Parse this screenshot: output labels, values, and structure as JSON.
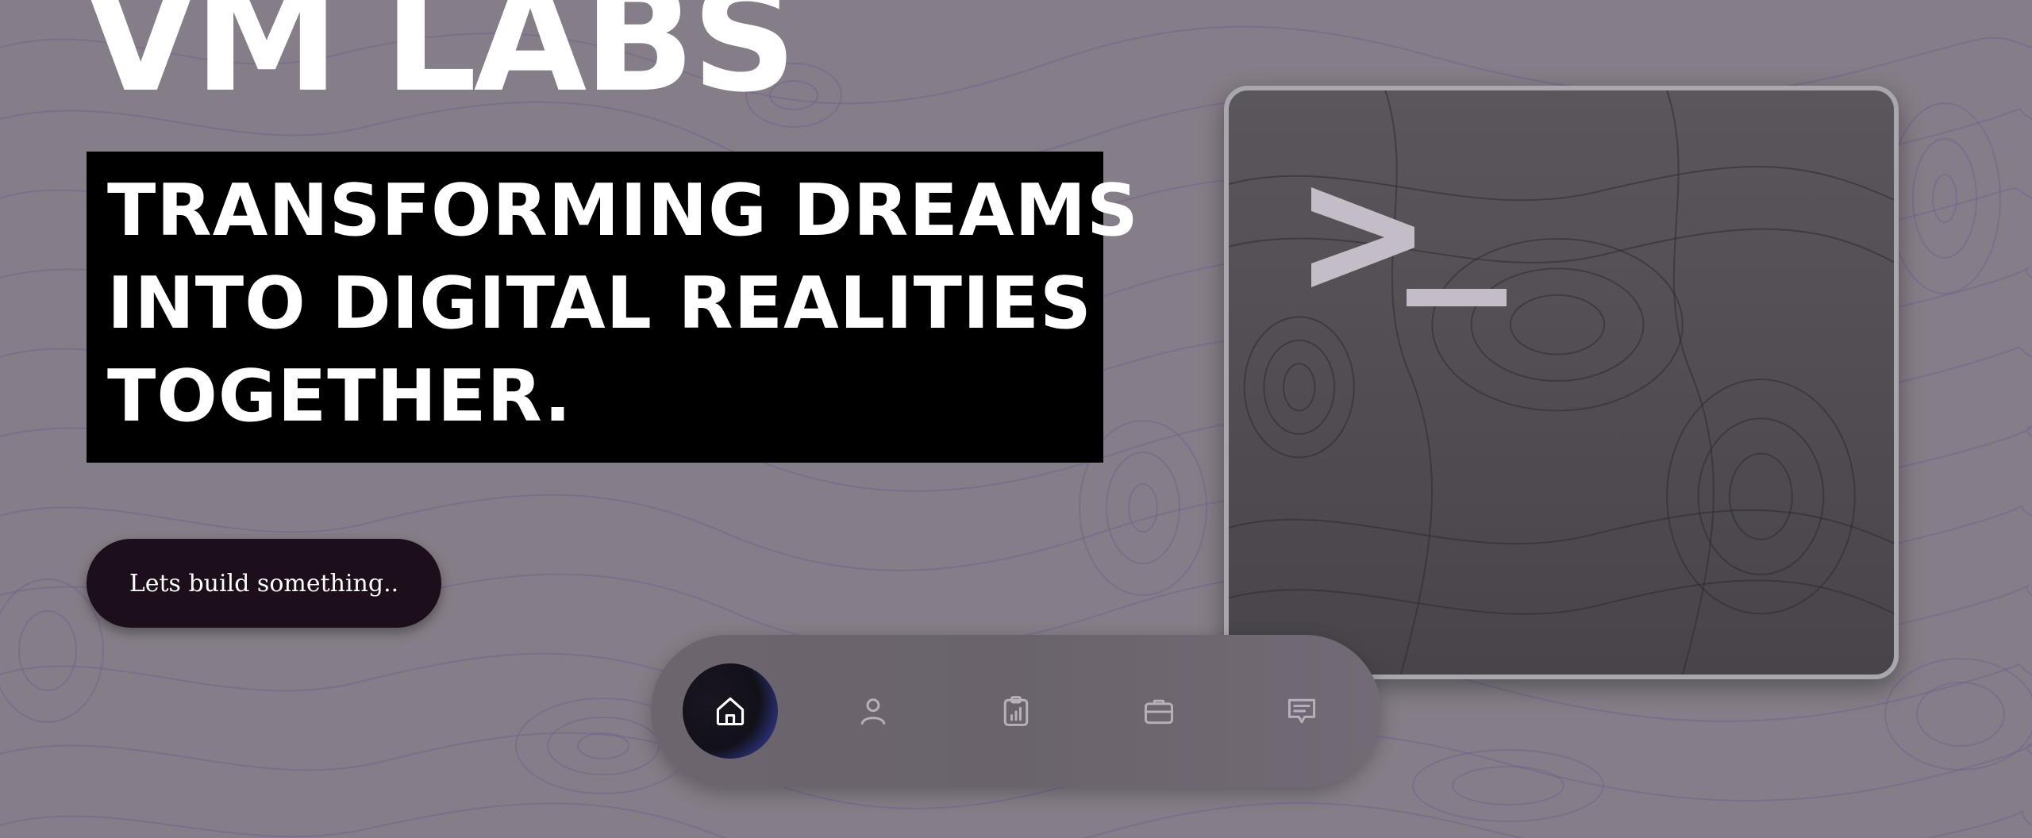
{
  "brand": {
    "name": "VM LABS"
  },
  "hero": {
    "lines": [
      "TRANSFORMING DREAMS",
      "INTO DIGITAL REALITIES",
      "TOGETHER."
    ]
  },
  "cta": {
    "label": "Lets build something.."
  },
  "terminal": {
    "icon": "terminal-prompt-icon"
  },
  "nav": {
    "items": [
      {
        "icon": "home-icon",
        "active": true
      },
      {
        "icon": "user-icon",
        "active": false
      },
      {
        "icon": "clipboard-chart-icon",
        "active": false
      },
      {
        "icon": "briefcase-icon",
        "active": false
      },
      {
        "icon": "message-icon",
        "active": false
      }
    ]
  },
  "colors": {
    "background": "#857d87",
    "topo_lines": "#6b5a94",
    "hero_box": "#000000",
    "cta_button": "#1d0e1c",
    "terminal_card": "#4e4a50",
    "nav_active_glow": "#4a5ad0"
  }
}
